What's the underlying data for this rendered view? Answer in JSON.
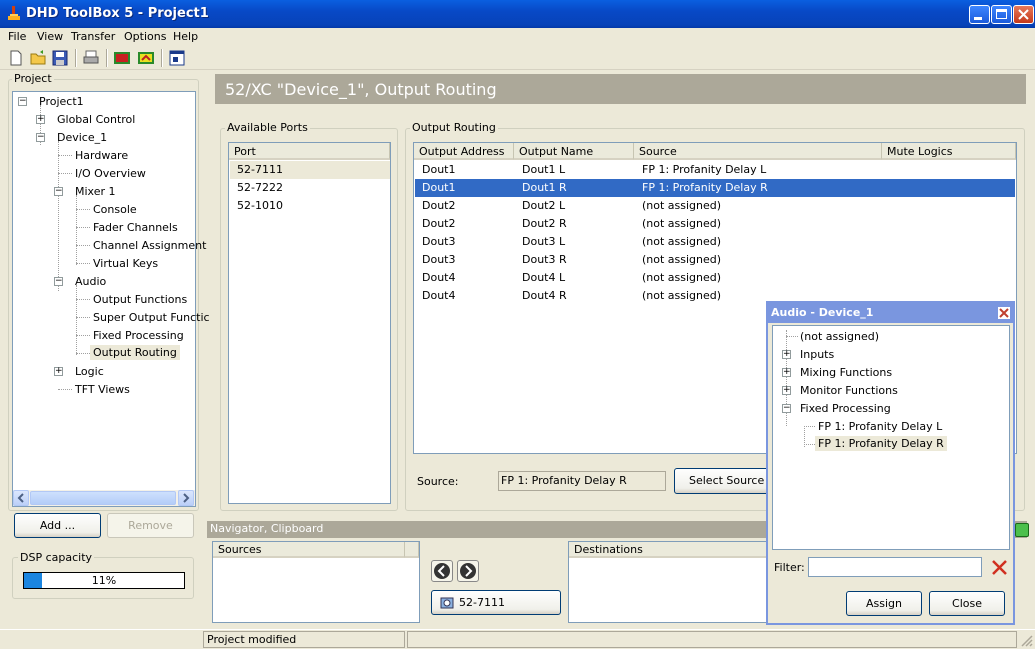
{
  "window": {
    "title": "DHD ToolBox 5 - Project1"
  },
  "menu": [
    "File",
    "View",
    "Transfer",
    "Options",
    "Help"
  ],
  "project_panel": {
    "label": "Project",
    "tree": [
      {
        "label": "Project1"
      },
      {
        "label": "Global Control"
      },
      {
        "label": "Device_1"
      },
      {
        "label": "Hardware"
      },
      {
        "label": "I/O Overview"
      },
      {
        "label": "Mixer 1"
      },
      {
        "label": "Console"
      },
      {
        "label": "Fader Channels"
      },
      {
        "label": "Channel Assignment"
      },
      {
        "label": "Virtual Keys"
      },
      {
        "label": "Audio"
      },
      {
        "label": "Output Functions"
      },
      {
        "label": "Super Output Functic"
      },
      {
        "label": "Fixed Processing"
      },
      {
        "label": "Output Routing"
      },
      {
        "label": "Logic"
      },
      {
        "label": "TFT Views"
      }
    ],
    "add_label": "Add ...",
    "remove_label": "Remove"
  },
  "dsp": {
    "label": "DSP capacity",
    "value_text": "11%",
    "value": 0.11
  },
  "header": {
    "title": "52/XC \"Device_1\", Output Routing"
  },
  "available_ports": {
    "label": "Available Ports",
    "column": "Port",
    "items": [
      "52-7111",
      "52-7222",
      "52-1010"
    ]
  },
  "output_routing": {
    "label": "Output Routing",
    "columns": [
      "Output Address",
      "Output Name",
      "Source",
      "Mute Logics"
    ],
    "rows": [
      {
        "addr": "Dout1",
        "name": "Dout1 L",
        "source": "FP 1: Profanity Delay L",
        "mute": ""
      },
      {
        "addr": "Dout1",
        "name": "Dout1 R",
        "source": "FP 1: Profanity Delay R",
        "mute": ""
      },
      {
        "addr": "Dout2",
        "name": "Dout2 L",
        "source": "(not assigned)",
        "mute": ""
      },
      {
        "addr": "Dout2",
        "name": "Dout2 R",
        "source": "(not assigned)",
        "mute": ""
      },
      {
        "addr": "Dout3",
        "name": "Dout3 L",
        "source": "(not assigned)",
        "mute": ""
      },
      {
        "addr": "Dout3",
        "name": "Dout3 R",
        "source": "(not assigned)",
        "mute": ""
      },
      {
        "addr": "Dout4",
        "name": "Dout4 L",
        "source": "(not assigned)",
        "mute": ""
      },
      {
        "addr": "Dout4",
        "name": "Dout4 R",
        "source": "(not assigned)",
        "mute": ""
      }
    ],
    "source_label": "Source:",
    "source_value": "FP 1: Profanity Delay R",
    "select_source_label": "Select Source ..."
  },
  "navigator": {
    "title": "Navigator, Clipboard",
    "sources_label": "Sources",
    "destinations_label": "Destinations",
    "port_button_label": "52-7111"
  },
  "status": {
    "text": "Project modified"
  },
  "dialog": {
    "title": "Audio - Device_1",
    "tree": [
      {
        "label": "(not assigned)"
      },
      {
        "label": "Inputs"
      },
      {
        "label": "Mixing Functions"
      },
      {
        "label": "Monitor Functions"
      },
      {
        "label": "Fixed Processing"
      },
      {
        "label": "FP 1: Profanity Delay L"
      },
      {
        "label": "FP 1: Profanity Delay R"
      }
    ],
    "filter_label": "Filter:",
    "filter_value": "",
    "assign_label": "Assign",
    "close_label": "Close"
  },
  "colors": {
    "title_blue": "#0849c6",
    "selection": "#316ac5",
    "header_bg": "#aca899"
  }
}
